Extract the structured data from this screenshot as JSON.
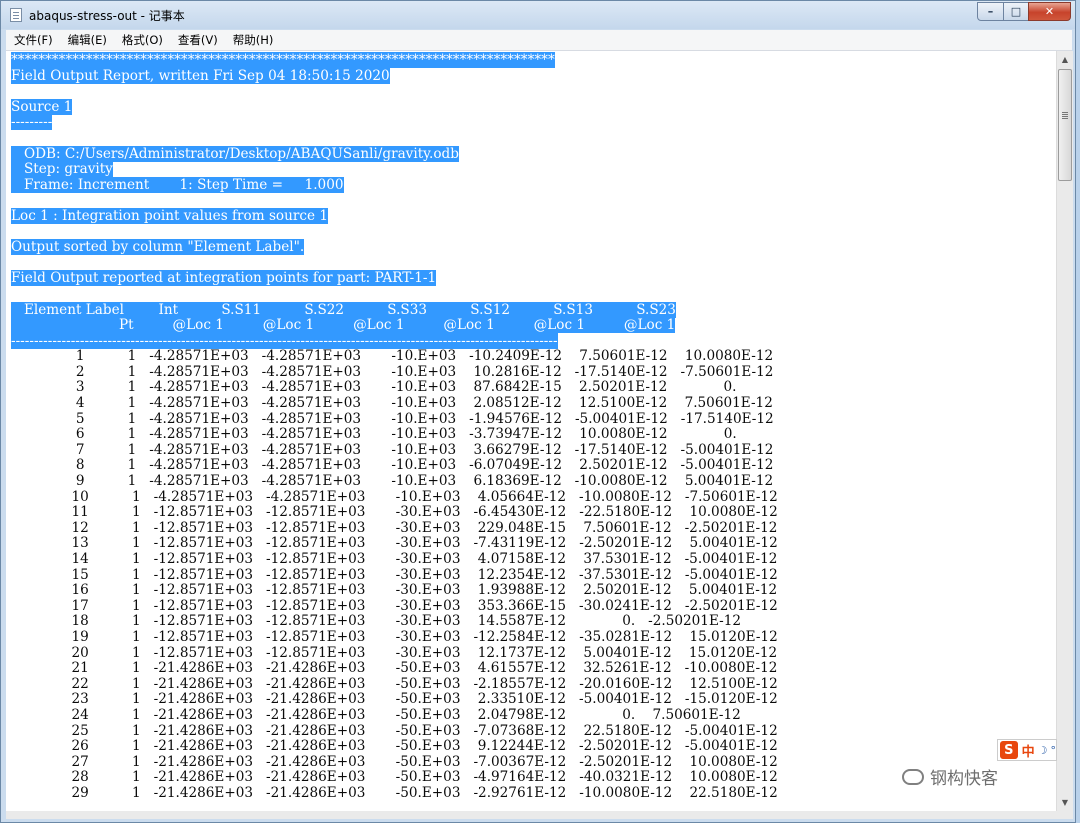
{
  "window": {
    "title": "abaqus-stress-out - 记事本"
  },
  "controls": {
    "minimize": "–",
    "maximize": "□",
    "close": "✕"
  },
  "menu": [
    "文件(F)",
    "编辑(E)",
    "格式(O)",
    "查看(V)",
    "帮助(H)"
  ],
  "ime": {
    "logo": "S",
    "lang": "中",
    "mode": "☽",
    "extra": "°"
  },
  "watermark": {
    "text": "钢构快客"
  },
  "document": {
    "header_lines": [
      "********************************************************************************",
      "Field Output Report, written Fri Sep 04 18:50:15 2020",
      "",
      "Source 1",
      "---------",
      "",
      "   ODB: C:/Users/Administrator/Desktop/ABAQUSanli/gravity.odb",
      "   Step: gravity",
      "   Frame: Increment       1: Step Time =     1.000",
      "",
      "Loc 1 : Integration point values from source 1",
      "",
      "Output sorted by column \"Element Label\".",
      "",
      "Field Output reported at integration points for part: PART-1-1",
      "",
      "   Element Label        Int          S.S11          S.S22          S.S33          S.S12          S.S13          S.S23",
      "                         Pt         @Loc 1         @Loc 1         @Loc 1         @Loc 1         @Loc 1         @Loc 1",
      "-----------------------------------------------------------------------------------------------------------------------"
    ],
    "rows": [
      [
        "1",
        "1",
        "-4.28571E+03",
        "-4.28571E+03",
        "-10.E+03",
        "-10.2409E-12",
        "7.50601E-12",
        "10.0080E-12"
      ],
      [
        "2",
        "1",
        "-4.28571E+03",
        "-4.28571E+03",
        "-10.E+03",
        "10.2816E-12",
        "-17.5140E-12",
        "-7.50601E-12"
      ],
      [
        "3",
        "1",
        "-4.28571E+03",
        "-4.28571E+03",
        "-10.E+03",
        "87.6842E-15",
        "2.50201E-12",
        "0."
      ],
      [
        "4",
        "1",
        "-4.28571E+03",
        "-4.28571E+03",
        "-10.E+03",
        "2.08512E-12",
        "12.5100E-12",
        "7.50601E-12"
      ],
      [
        "5",
        "1",
        "-4.28571E+03",
        "-4.28571E+03",
        "-10.E+03",
        "-1.94576E-12",
        "-5.00401E-12",
        "-17.5140E-12"
      ],
      [
        "6",
        "1",
        "-4.28571E+03",
        "-4.28571E+03",
        "-10.E+03",
        "-3.73947E-12",
        "10.0080E-12",
        "0."
      ],
      [
        "7",
        "1",
        "-4.28571E+03",
        "-4.28571E+03",
        "-10.E+03",
        "3.66279E-12",
        "-17.5140E-12",
        "-5.00401E-12"
      ],
      [
        "8",
        "1",
        "-4.28571E+03",
        "-4.28571E+03",
        "-10.E+03",
        "-6.07049E-12",
        "2.50201E-12",
        "-5.00401E-12"
      ],
      [
        "9",
        "1",
        "-4.28571E+03",
        "-4.28571E+03",
        "-10.E+03",
        "6.18369E-12",
        "-10.0080E-12",
        "5.00401E-12"
      ],
      [
        "10",
        "1",
        "-4.28571E+03",
        "-4.28571E+03",
        "-10.E+03",
        "4.05664E-12",
        "-10.0080E-12",
        "-7.50601E-12"
      ],
      [
        "11",
        "1",
        "-12.8571E+03",
        "-12.8571E+03",
        "-30.E+03",
        "-6.45430E-12",
        "-22.5180E-12",
        "10.0080E-12"
      ],
      [
        "12",
        "1",
        "-12.8571E+03",
        "-12.8571E+03",
        "-30.E+03",
        "229.048E-15",
        "7.50601E-12",
        "-2.50201E-12"
      ],
      [
        "13",
        "1",
        "-12.8571E+03",
        "-12.8571E+03",
        "-30.E+03",
        "-7.43119E-12",
        "-2.50201E-12",
        "5.00401E-12"
      ],
      [
        "14",
        "1",
        "-12.8571E+03",
        "-12.8571E+03",
        "-30.E+03",
        "4.07158E-12",
        "37.5301E-12",
        "-5.00401E-12"
      ],
      [
        "15",
        "1",
        "-12.8571E+03",
        "-12.8571E+03",
        "-30.E+03",
        "12.2354E-12",
        "-37.5301E-12",
        "-5.00401E-12"
      ],
      [
        "16",
        "1",
        "-12.8571E+03",
        "-12.8571E+03",
        "-30.E+03",
        "1.93988E-12",
        "2.50201E-12",
        "5.00401E-12"
      ],
      [
        "17",
        "1",
        "-12.8571E+03",
        "-12.8571E+03",
        "-30.E+03",
        "353.366E-15",
        "-30.0241E-12",
        "-2.50201E-12"
      ],
      [
        "18",
        "1",
        "-12.8571E+03",
        "-12.8571E+03",
        "-30.E+03",
        "14.5587E-12",
        "0.",
        "-2.50201E-12"
      ],
      [
        "19",
        "1",
        "-12.8571E+03",
        "-12.8571E+03",
        "-30.E+03",
        "-12.2584E-12",
        "-35.0281E-12",
        "15.0120E-12"
      ],
      [
        "20",
        "1",
        "-12.8571E+03",
        "-12.8571E+03",
        "-30.E+03",
        "12.1737E-12",
        "5.00401E-12",
        "15.0120E-12"
      ],
      [
        "21",
        "1",
        "-21.4286E+03",
        "-21.4286E+03",
        "-50.E+03",
        "4.61557E-12",
        "32.5261E-12",
        "-10.0080E-12"
      ],
      [
        "22",
        "1",
        "-21.4286E+03",
        "-21.4286E+03",
        "-50.E+03",
        "-2.18557E-12",
        "-20.0160E-12",
        "12.5100E-12"
      ],
      [
        "23",
        "1",
        "-21.4286E+03",
        "-21.4286E+03",
        "-50.E+03",
        "2.33510E-12",
        "-5.00401E-12",
        "-15.0120E-12"
      ],
      [
        "24",
        "1",
        "-21.4286E+03",
        "-21.4286E+03",
        "-50.E+03",
        "2.04798E-12",
        "0.",
        "7.50601E-12"
      ],
      [
        "25",
        "1",
        "-21.4286E+03",
        "-21.4286E+03",
        "-50.E+03",
        "-7.07368E-12",
        "22.5180E-12",
        "-5.00401E-12"
      ],
      [
        "26",
        "1",
        "-21.4286E+03",
        "-21.4286E+03",
        "-50.E+03",
        "9.12244E-12",
        "-2.50201E-12",
        "-5.00401E-12"
      ],
      [
        "27",
        "1",
        "-21.4286E+03",
        "-21.4286E+03",
        "-50.E+03",
        "-7.00367E-12",
        "-2.50201E-12",
        "10.0080E-12"
      ],
      [
        "28",
        "1",
        "-21.4286E+03",
        "-21.4286E+03",
        "-50.E+03",
        "-4.97164E-12",
        "-40.0321E-12",
        "10.0080E-12"
      ],
      [
        "29",
        "1",
        "-21.4286E+03",
        "-21.4286E+03",
        "-50.E+03",
        "-2.92761E-12",
        "-10.0080E-12",
        "22.5180E-12"
      ]
    ]
  }
}
